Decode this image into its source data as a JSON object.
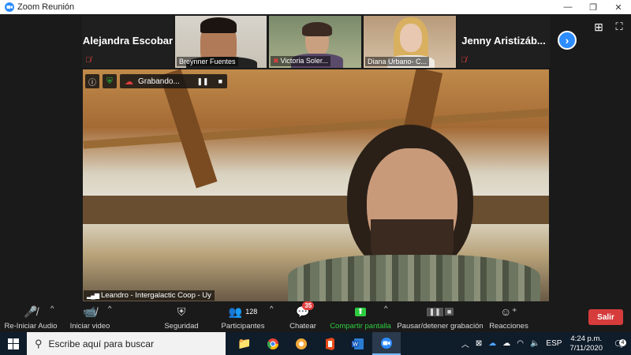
{
  "window": {
    "title": "Zoom Reunión",
    "controls": [
      "—",
      "❐",
      "✕"
    ]
  },
  "gallery": {
    "tiles": [
      {
        "name": "Alejandra Escobar",
        "muted": true,
        "video": false
      },
      {
        "name": "Breynner Fuentes",
        "muted": false,
        "video": true
      },
      {
        "name": "Victoria Soler...",
        "muted": true,
        "video": true
      },
      {
        "name": "Diana Urbano- C...",
        "muted": false,
        "video": true
      },
      {
        "name": "Jenny  Aristizáb...",
        "muted": true,
        "video": false
      }
    ],
    "next_icon": "chevron-right-icon",
    "gallery_view_icon": "grid-icon",
    "fullscreen_icon": "fullscreen-icon"
  },
  "recording": {
    "label": "Grabando...",
    "pause_glyph": "❚❚",
    "stop_glyph": "■"
  },
  "active_speaker": {
    "name": "Leandro - Intergalactic Coop - Uy"
  },
  "toolbar": {
    "audio_label": "Re-Iniciar Audio",
    "video_label": "Iniciar video",
    "security_label": "Seguridad",
    "participants_label": "Participantes",
    "participants_count": "128",
    "chat_label": "Chatear",
    "chat_badge": "35",
    "share_label": "Compartir pantalla",
    "record_label": "Pausar/detener grabación",
    "reactions_label": "Reacciones",
    "leave_label": "Salir",
    "accent_green": "#2ecc40",
    "leave_color": "#d63c3c"
  },
  "taskbar": {
    "search_placeholder": "Escribe aquí para buscar",
    "language": "ESP",
    "time": "4:24 p.m.",
    "date": "7/11/2020",
    "notifications": "4"
  }
}
